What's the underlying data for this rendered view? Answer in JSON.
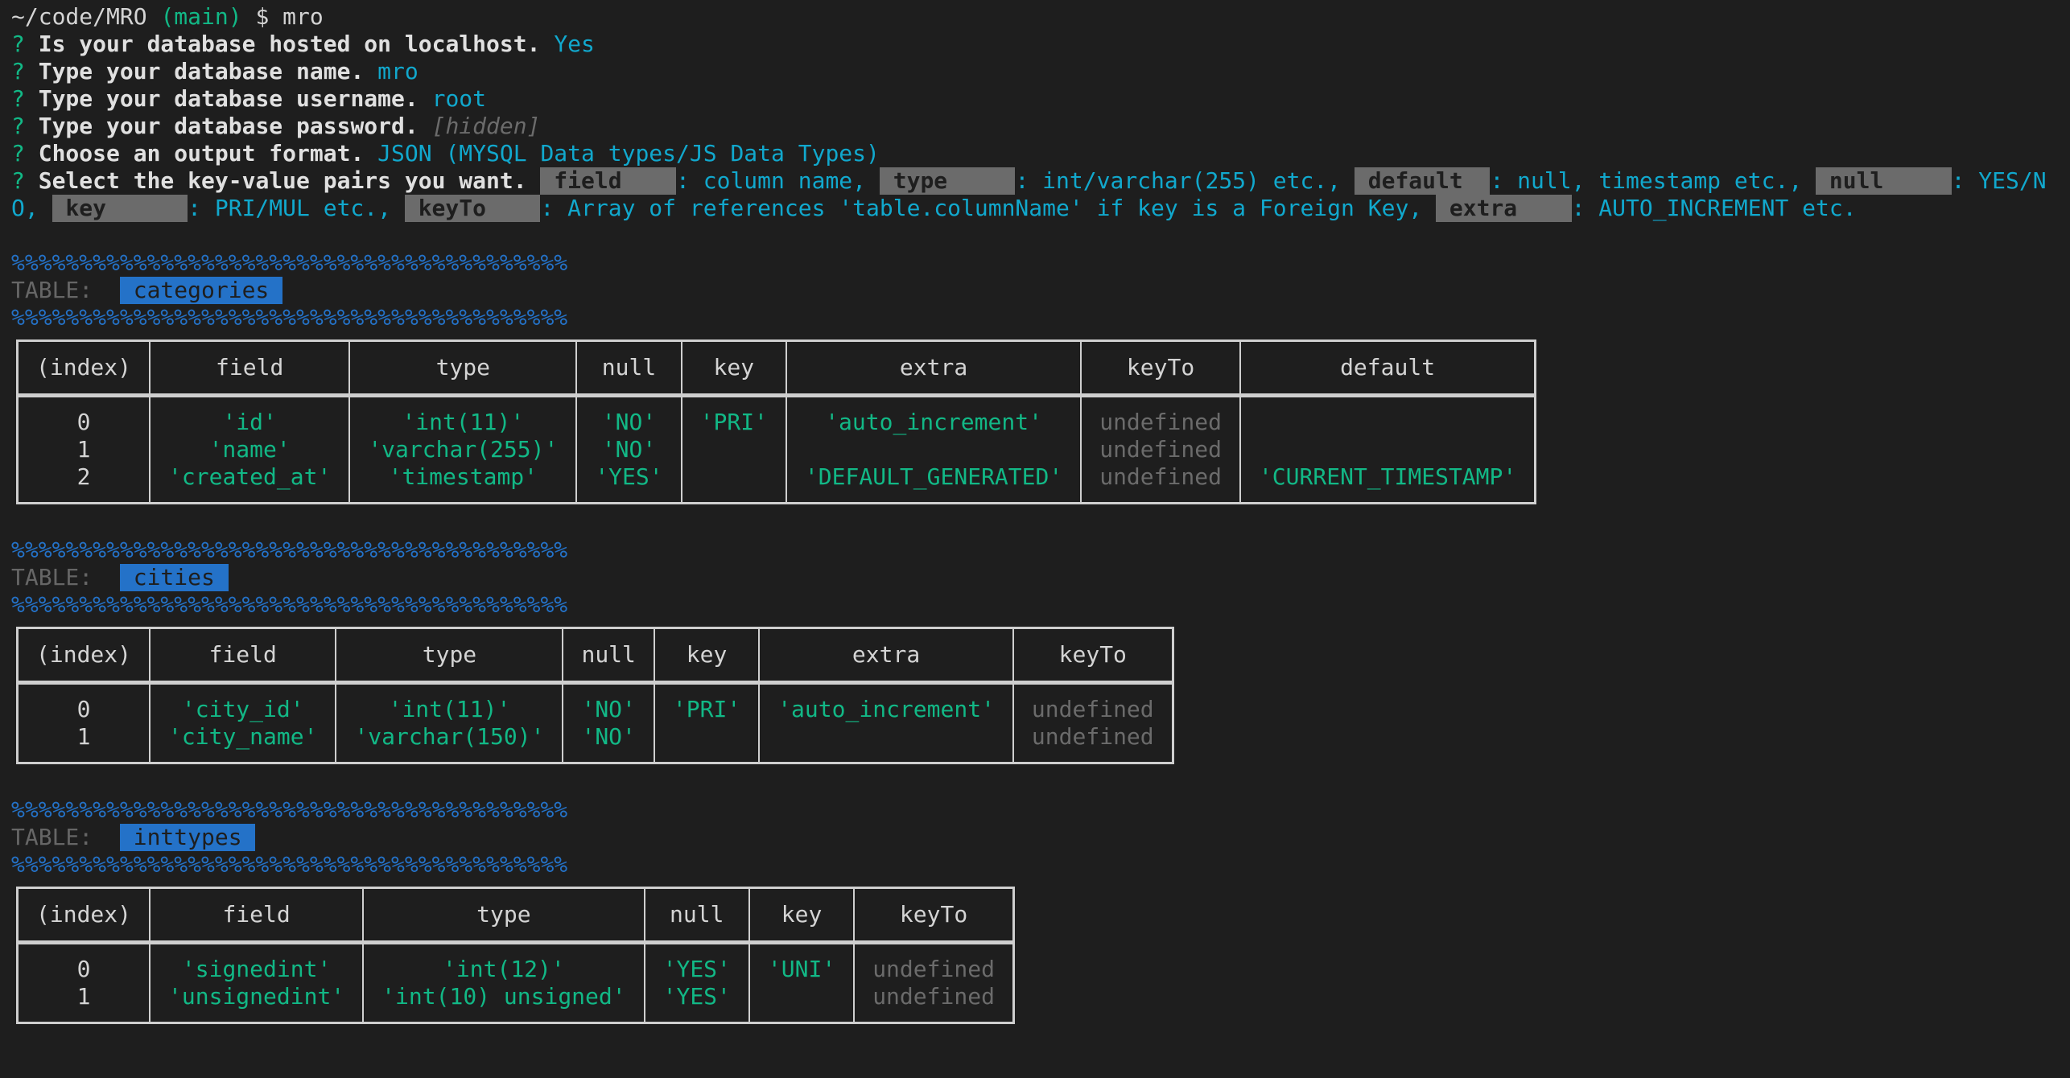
{
  "prompt": {
    "path": "~/code/MRO",
    "branch": "(main)",
    "symbol": "$",
    "command": "mro"
  },
  "questions": [
    {
      "mark": "?",
      "text": "Is your database hosted on localhost.",
      "answer": "Yes",
      "style": "cyan"
    },
    {
      "mark": "?",
      "text": "Type your database name.",
      "answer": "mro",
      "style": "cyan"
    },
    {
      "mark": "?",
      "text": "Type your database username.",
      "answer": "root",
      "style": "cyan"
    },
    {
      "mark": "?",
      "text": "Type your database password.",
      "answer": "[hidden]",
      "style": "dim-italic"
    },
    {
      "mark": "?",
      "text": "Choose an output format.",
      "answer": "JSON (MYSQL Data types/JS Data Types)",
      "style": "cyan"
    }
  ],
  "keyvalue_question": {
    "mark": "?",
    "text": "Select the key-value pairs you want.",
    "pairs": [
      {
        "tag": "field",
        "desc": ": column name, "
      },
      {
        "tag": "type",
        "desc": ": int/varchar(255) etc., "
      },
      {
        "tag": "default",
        "desc": ": null, timestamp etc., "
      },
      {
        "tag": "null",
        "desc": ": YES/NO, "
      },
      {
        "tag": "key",
        "desc": ": PRI/MUL etc., "
      },
      {
        "tag": "keyTo",
        "desc": ": Array of references 'table.columnName' if key is a Foreign Key, "
      },
      {
        "tag": "extra",
        "desc": ": AUTO_INCREMENT etc."
      }
    ]
  },
  "separator": "%%%%%%%%%%%%%%%%%%%%%%%%%%%%%%%%%%%%%%%%%",
  "table_label": "TABLE:",
  "tables": [
    {
      "name": "categories",
      "headers": [
        "(index)",
        "field",
        "type",
        "null",
        "key",
        "extra",
        "keyTo",
        "default"
      ],
      "rows": [
        [
          "0",
          "'id'",
          "'int(11)'",
          "'NO'",
          "'PRI'",
          "'auto_increment'",
          "undefined",
          ""
        ],
        [
          "1",
          "'name'",
          "'varchar(255)'",
          "'NO'",
          "",
          "",
          "undefined",
          ""
        ],
        [
          "2",
          "'created_at'",
          "'timestamp'",
          "'YES'",
          "",
          "'DEFAULT_GENERATED'",
          "undefined",
          "'CURRENT_TIMESTAMP'"
        ]
      ]
    },
    {
      "name": "cities",
      "headers": [
        "(index)",
        "field",
        "type",
        "null",
        "key",
        "extra",
        "keyTo"
      ],
      "rows": [
        [
          "0",
          "'city_id'",
          "'int(11)'",
          "'NO'",
          "'PRI'",
          "'auto_increment'",
          "undefined"
        ],
        [
          "1",
          "'city_name'",
          "'varchar(150)'",
          "'NO'",
          "",
          "",
          "undefined"
        ]
      ]
    },
    {
      "name": "inttypes",
      "headers": [
        "(index)",
        "field",
        "type",
        "null",
        "key",
        "keyTo"
      ],
      "rows": [
        [
          "0",
          "'signedint'",
          "'int(12)'",
          "'YES'",
          "'UNI'",
          "undefined"
        ],
        [
          "1",
          "'unsignedint'",
          "'int(10) unsigned'",
          "'YES'",
          "",
          "undefined"
        ]
      ]
    }
  ]
}
